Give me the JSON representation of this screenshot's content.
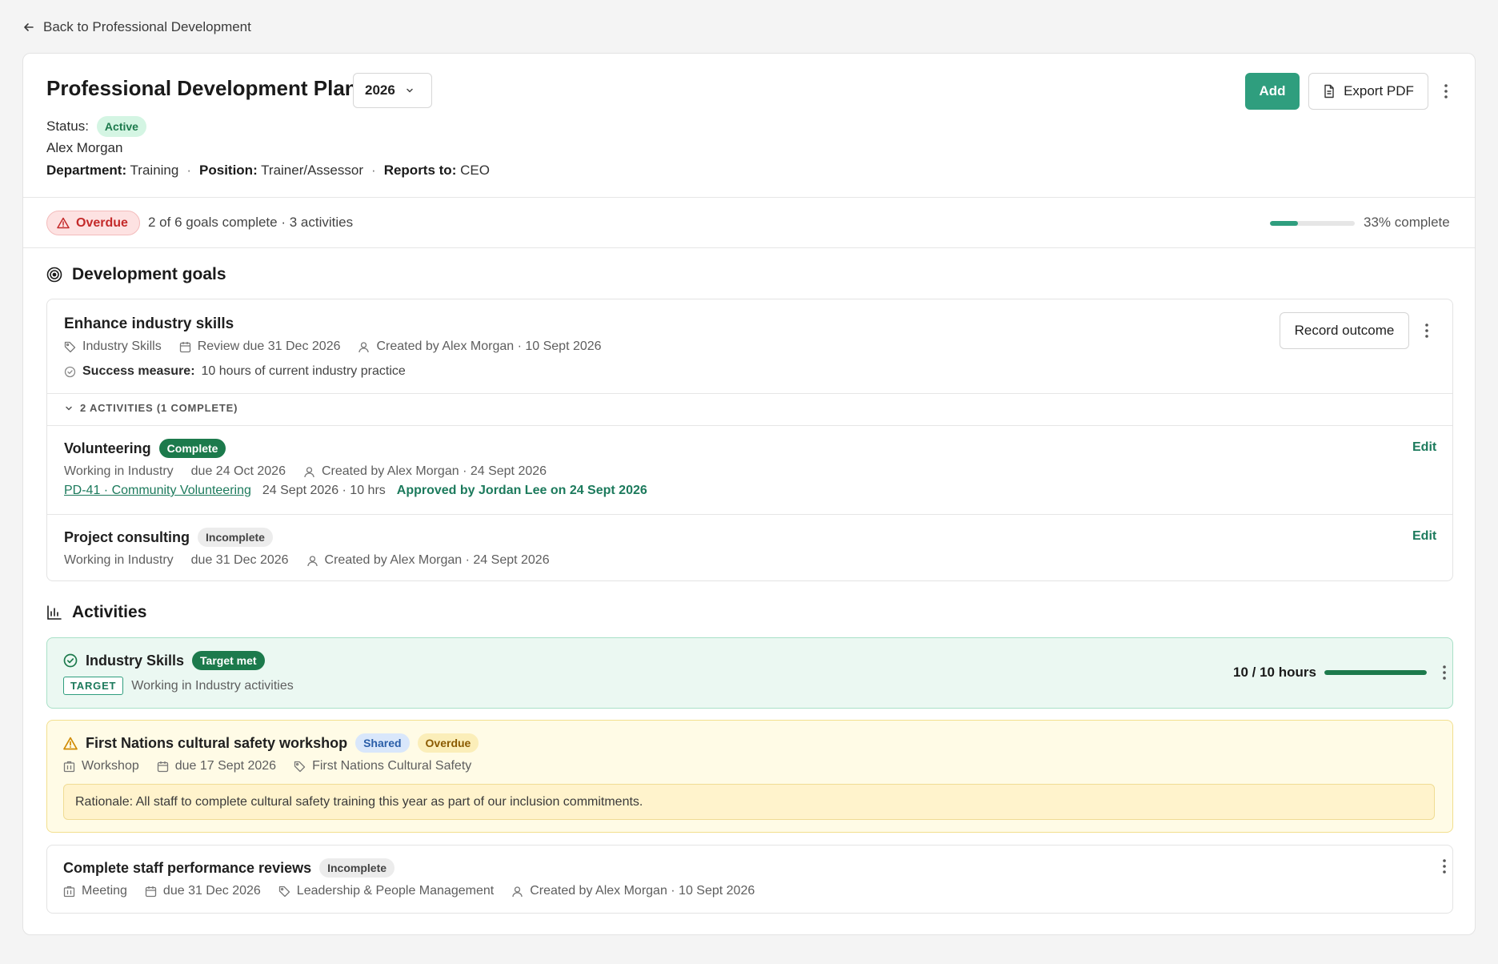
{
  "nav": {
    "back_label": "Back to Professional Development"
  },
  "header": {
    "title": "Professional Development Plan",
    "year": "2026",
    "add_label": "Add",
    "export_label": "Export PDF",
    "status_label": "Status:",
    "status_value": "Active",
    "employee_name": "Alex Morgan",
    "department_label": "Department:",
    "department_value": "Training",
    "position_label": "Position:",
    "position_value": "Trainer/Assessor",
    "reports_label": "Reports to:",
    "reports_value": "CEO",
    "separator": "·"
  },
  "summary": {
    "overdue_label": "Overdue",
    "text": "2 of 6 goals complete · 3 activities",
    "progress_fraction": 0.33,
    "progress_text": "33% complete"
  },
  "goals_section": {
    "title": "Development goals",
    "goal": {
      "title": "Enhance industry skills",
      "category": "Industry Skills",
      "review": "Review due 31 Dec 2026",
      "created": "Created by Alex Morgan · 10 Sept 2026",
      "success_label": "Success measure:",
      "success_value": "10 hours of current industry practice",
      "record_label": "Record outcome",
      "activities_toggle": "2 ACTIVITIES (1 COMPLETE)",
      "activities": [
        {
          "title": "Volunteering",
          "status": "Complete",
          "type": "Working in Industry",
          "due": "due 24 Oct 2026",
          "created": "Created by Alex Morgan · 24 Sept 2026",
          "edit_label": "Edit",
          "evidence_link": "PD-41 · Community Volunteering",
          "evidence_detail": "24 Sept 2026 · 10 hrs",
          "approved": "Approved by Jordan Lee on 24 Sept 2026"
        },
        {
          "title": "Project consulting",
          "status": "Incomplete",
          "type": "Working in Industry",
          "due": "due 31 Dec 2026",
          "created": "Created by Alex Morgan · 24 Sept 2026",
          "edit_label": "Edit"
        }
      ]
    }
  },
  "activities_section": {
    "title": "Activities",
    "target": {
      "title": "Industry Skills",
      "badge": "Target met",
      "tag": "TARGET",
      "description": "Working in Industry activities",
      "hours_text": "10 / 10 hours",
      "hours_fraction": 1.0
    },
    "workshop": {
      "title": "First Nations cultural safety workshop",
      "badge_shared": "Shared",
      "badge_overdue": "Overdue",
      "type": "Workshop",
      "due": "due 17 Sept 2026",
      "category": "First Nations Cultural Safety",
      "rationale": "Rationale: All staff to complete cultural safety training this year as part of our inclusion commitments."
    },
    "reviews": {
      "title": "Complete staff performance reviews",
      "status": "Incomplete",
      "type": "Meeting",
      "due": "due 31 Dec 2026",
      "category": "Leadership & People Management",
      "created": "Created by Alex Morgan · 10 Sept 2026"
    }
  },
  "colors": {
    "accent": "#2f9e7e",
    "success_dark": "#1c7a4c",
    "overdue_red": "#c42a2a",
    "warning_yellow": "#fffbe6"
  },
  "icons": [
    "arrow-left-icon",
    "chevron-down-icon",
    "file-icon",
    "kebab-icon",
    "warning-icon",
    "target-icon",
    "tag-icon",
    "calendar-icon",
    "user-icon",
    "check-circle-icon",
    "bar-chart-icon",
    "building-icon"
  ]
}
